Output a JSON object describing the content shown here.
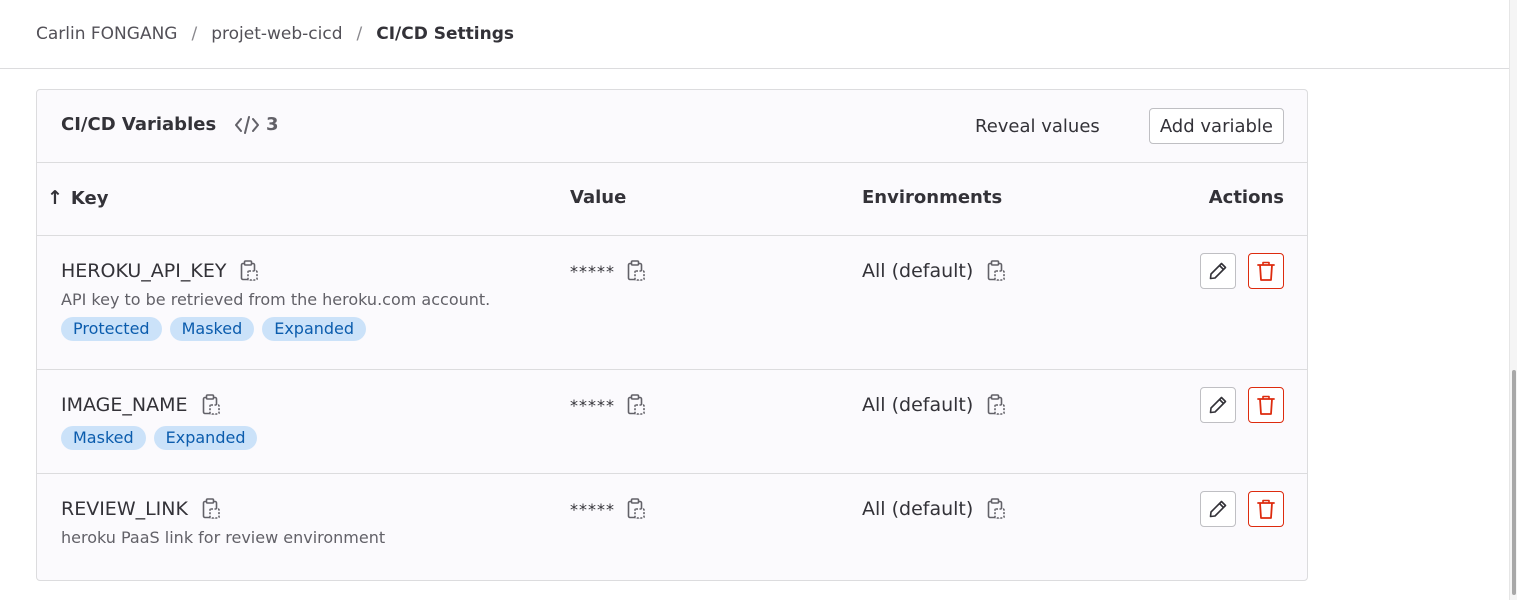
{
  "breadcrumb": {
    "items": [
      "Carlin FONGANG",
      "projet-web-cicd",
      "CI/CD Settings"
    ],
    "separator": "/"
  },
  "card": {
    "title": "CI/CD Variables",
    "count": "3",
    "reveal_label": "Reveal values",
    "add_label": "Add variable"
  },
  "table": {
    "headers": {
      "key": "Key",
      "value": "Value",
      "environments": "Environments",
      "actions": "Actions"
    },
    "sort_indicator": "↑",
    "rows": [
      {
        "key": "HEROKU_API_KEY",
        "description": "API key to be retrieved from the heroku.com account.",
        "badges": [
          "Protected",
          "Masked",
          "Expanded"
        ],
        "value": "*****",
        "environment": "All (default)"
      },
      {
        "key": "IMAGE_NAME",
        "description": "",
        "badges": [
          "Masked",
          "Expanded"
        ],
        "value": "*****",
        "environment": "All (default)"
      },
      {
        "key": "REVIEW_LINK",
        "description": "heroku PaaS link for review environment",
        "badges": [],
        "value": "*****",
        "environment": "All (default)"
      }
    ]
  },
  "icons": {
    "copy": "clipboard-copy-icon",
    "edit": "pencil-icon",
    "delete": "trash-icon",
    "code": "code-icon",
    "sort": "arrow-up-icon"
  },
  "colors": {
    "badge_bg": "#cbe2f9",
    "badge_text": "#0b5cad",
    "danger": "#dd2b0e",
    "border": "#dcdcde"
  }
}
